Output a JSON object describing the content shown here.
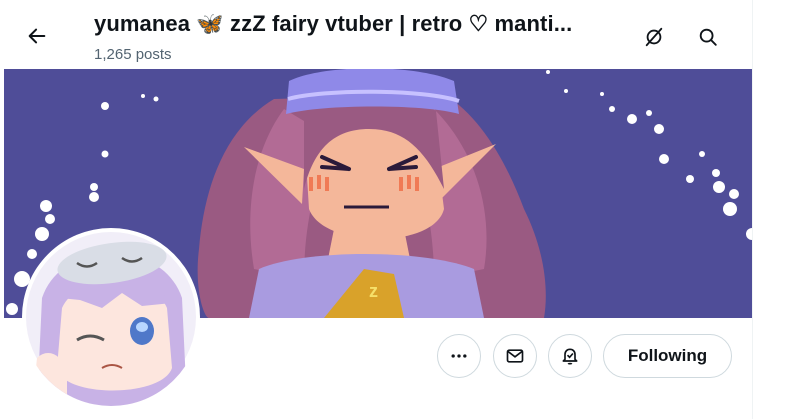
{
  "header": {
    "title": "yumanea 🦋 zzZ fairy vtuber | retro ♡ manti...",
    "post_count": "1,265 posts"
  },
  "icons": {
    "back": "arrow-left-icon",
    "grok": "grok-icon",
    "search": "search-icon",
    "more": "more-dots-icon",
    "message": "mail-icon",
    "notify": "bell-icon"
  },
  "banner": {
    "background": "#4f4d98"
  },
  "actions": {
    "follow_label": "Following"
  }
}
